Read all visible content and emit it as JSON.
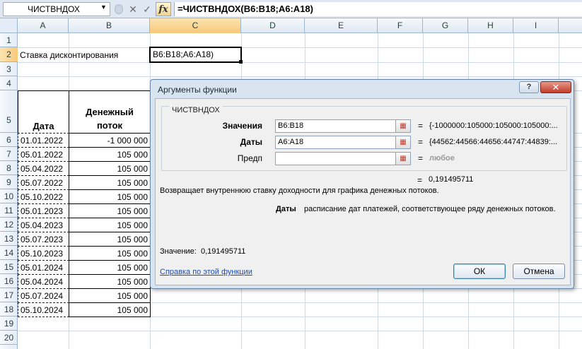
{
  "formula_bar": {
    "name_box": "ЧИСТВНДОХ",
    "cancel_glyph": "✕",
    "enter_glyph": "✓",
    "fx_label": "fx",
    "formula": "=ЧИСТВНДОХ(B6:B18;A6:A18)"
  },
  "columns": [
    "A",
    "B",
    "C",
    "D",
    "E",
    "F",
    "G",
    "H",
    "I"
  ],
  "rows": [
    "1",
    "2",
    "3",
    "4",
    "5",
    "6",
    "7",
    "8",
    "9",
    "10",
    "11",
    "12",
    "13",
    "14",
    "15",
    "16",
    "17",
    "18",
    "19",
    "20"
  ],
  "sheet": {
    "label_a2": "Ставка дисконтирования",
    "edit_c2": "B6:B18;A6:A18)",
    "header_date": "Дата",
    "header_flow_1": "Денежный",
    "header_flow_2": "поток",
    "dates": [
      "01.01.2022",
      "05.01.2022",
      "05.04.2022",
      "05.07.2022",
      "05.10.2022",
      "05.01.2023",
      "05.04.2023",
      "05.07.2023",
      "05.10.2023",
      "05.01.2024",
      "05.04.2024",
      "05.07.2024",
      "05.10.2024"
    ],
    "flows": [
      "-1 000 000",
      "105 000",
      "105 000",
      "105 000",
      "105 000",
      "105 000",
      "105 000",
      "105 000",
      "105 000",
      "105 000",
      "105 000",
      "105 000",
      "105 000"
    ]
  },
  "dialog": {
    "title": "Аргументы функции",
    "help_glyph": "?",
    "close_glyph": "✕",
    "function_name": "ЧИСТВНДОХ",
    "args": [
      {
        "label": "Значения",
        "value": "B6:B18",
        "result": "{-1000000:105000:105000:105000:..."
      },
      {
        "label": "Даты",
        "value": "A6:A18",
        "result": "{44562:44566:44656:44747:44839:..."
      },
      {
        "label": "Предп",
        "value": "",
        "result": "любое"
      }
    ],
    "equals": "=",
    "total_result": "0,191495711",
    "description": "Возвращает внутреннюю ставку доходности для графика денежных потоков.",
    "arg_desc_name": "Даты",
    "arg_desc_text": "расписание дат платежей, соответствующее ряду денежных потоков.",
    "value_label": "Значение:",
    "value": "0,191495711",
    "help_link": "Справка по этой функции",
    "ok_label": "ОК",
    "cancel_label": "Отмена"
  }
}
